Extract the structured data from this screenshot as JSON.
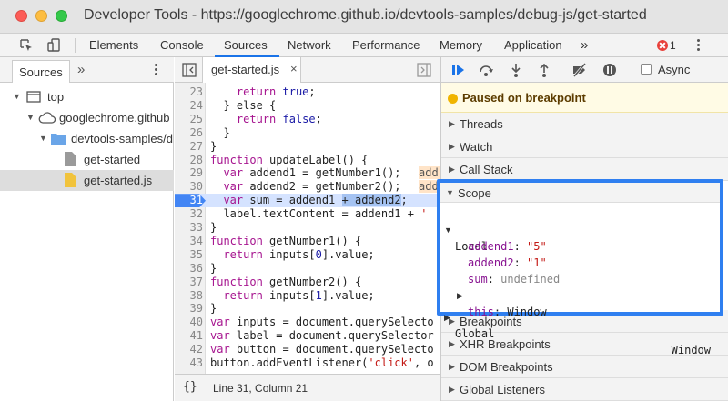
{
  "window": {
    "title": "Developer Tools - https://googlechrome.github.io/devtools-samples/debug-js/get-started"
  },
  "toolbar": {
    "tabs": [
      "Elements",
      "Console",
      "Sources",
      "Network",
      "Performance",
      "Memory",
      "Application"
    ],
    "active_tab": "Sources",
    "overflow": "»",
    "error_count": "1",
    "icons": [
      "inspect-element-icon",
      "device-toolbar-icon",
      "error-icon",
      "kebab-menu-icon"
    ]
  },
  "navigator": {
    "tab_label": "Sources",
    "overflow": "»",
    "tree": [
      {
        "label": "top",
        "icon": "frame-icon"
      },
      {
        "label": "googlechrome.github",
        "icon": "cloud-icon"
      },
      {
        "label": "devtools-samples/d",
        "icon": "folder-icon"
      },
      {
        "label": "get-started",
        "icon": "file-icon"
      },
      {
        "label": "get-started.js",
        "icon": "js-file-icon"
      }
    ]
  },
  "editor": {
    "tab_label": "get-started.js",
    "close": "×",
    "lines": [
      {
        "n": "23",
        "code": "    return true;"
      },
      {
        "n": "24",
        "code": "  } else {"
      },
      {
        "n": "25",
        "code": "    return false;"
      },
      {
        "n": "26",
        "code": "  }"
      },
      {
        "n": "27",
        "code": "}"
      },
      {
        "n": "28",
        "code": "function updateLabel() {"
      },
      {
        "n": "29",
        "code": "  var addend1 = getNumber1();"
      },
      {
        "n": "30",
        "code": "  var addend2 = getNumber2();"
      },
      {
        "n": "31",
        "code": "  var sum = addend1 + addend2;"
      },
      {
        "n": "32",
        "code": "  label.textContent = addend1 + '"
      },
      {
        "n": "33",
        "code": "}"
      },
      {
        "n": "34",
        "code": "function getNumber1() {"
      },
      {
        "n": "35",
        "code": "  return inputs[0].value;"
      },
      {
        "n": "36",
        "code": "}"
      },
      {
        "n": "37",
        "code": "function getNumber2() {"
      },
      {
        "n": "38",
        "code": "  return inputs[1].value;"
      },
      {
        "n": "39",
        "code": "}"
      },
      {
        "n": "40",
        "code": "var inputs = document.querySelecto"
      },
      {
        "n": "41",
        "code": "var label = document.querySelector"
      },
      {
        "n": "42",
        "code": "var button = document.querySelecto"
      },
      {
        "n": "43",
        "code": "button.addEventListener('click', o"
      }
    ],
    "inline_values": [
      "add",
      "add"
    ],
    "footer_brace": "{}",
    "cursor_position": "Line 31, Column 21"
  },
  "debugger": {
    "async_label": "Async",
    "paused_text": "Paused on breakpoint",
    "panes_above": [
      "Threads",
      "Watch",
      "Call Stack"
    ],
    "scope": {
      "title": "Scope",
      "local_label": "Local",
      "vars": [
        {
          "name": "addend1",
          "value": "\"5\""
        },
        {
          "name": "addend2",
          "value": "\"1\""
        },
        {
          "name": "sum",
          "value": "undefined"
        }
      ],
      "this_name": "this",
      "this_value": "Window",
      "global_label": "Global",
      "global_value": "Window"
    },
    "panes_below": [
      "Breakpoints",
      "XHR Breakpoints",
      "DOM Breakpoints",
      "Global Listeners"
    ]
  },
  "colors": {
    "accent": "#1a73e8",
    "scope_highlight": "#2f7ff0",
    "breakpoint": "#4285f4",
    "paused_bg": "#fffbe5"
  }
}
